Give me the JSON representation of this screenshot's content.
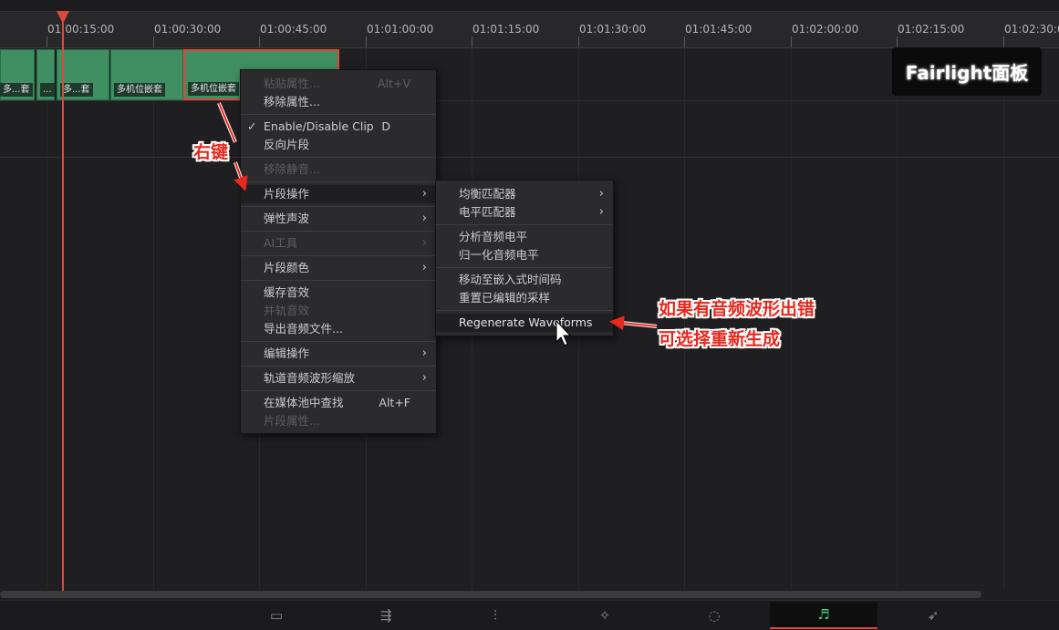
{
  "ruler": {
    "timecodes": [
      "01:00:15:00",
      "01:00:30:00",
      "01:00:45:00",
      "01:01:00:00",
      "01:01:15:00",
      "01:01:30:00",
      "01:01:45:00",
      "01:02:00:00",
      "01:02:15:00",
      "01:02:30:00"
    ]
  },
  "clips": [
    {
      "label": "多...套"
    },
    {
      "label": "..."
    },
    {
      "label": "多...套"
    },
    {
      "label": "多机位嵌套"
    },
    {
      "label": "多机位嵌套"
    }
  ],
  "badge": {
    "text": "Fairlight面板"
  },
  "context_menu": {
    "items": [
      {
        "label": "粘贴属性...",
        "shortcut": "Alt+V",
        "disabled": true
      },
      {
        "label": "移除属性...",
        "disabled": false
      },
      {
        "label": "Enable/Disable Clip",
        "shortcut": "D",
        "checked": true
      },
      {
        "label": "反向片段"
      },
      {
        "label": "移除静音...",
        "disabled": true
      },
      {
        "label": "片段操作",
        "submenu": true,
        "hover": true
      },
      {
        "label": "弹性声波",
        "submenu": true
      },
      {
        "label": "AI工具",
        "submenu": true,
        "disabled": true
      },
      {
        "label": "片段颜色",
        "submenu": true
      },
      {
        "label": "缓存音效"
      },
      {
        "label": "并轨音效",
        "disabled": true
      },
      {
        "label": "导出音频文件..."
      },
      {
        "label": "编辑操作",
        "submenu": true
      },
      {
        "label": "轨道音频波形缩放",
        "submenu": true
      },
      {
        "label": "在媒体池中查找",
        "shortcut": "Alt+F"
      },
      {
        "label": "片段属性...",
        "disabled": true
      }
    ]
  },
  "submenu": {
    "items": [
      {
        "label": "均衡匹配器",
        "submenu": true
      },
      {
        "label": "电平匹配器",
        "submenu": true
      },
      {
        "label": "分析音频电平"
      },
      {
        "label": "归一化音频电平"
      },
      {
        "label": "移动至嵌入式时间码"
      },
      {
        "label": "重置已编辑的采样"
      },
      {
        "label": "Regenerate Waveforms",
        "hover": true
      }
    ]
  },
  "annotations": {
    "right_click": "右键",
    "tip_line1": "如果有音频波形出错",
    "tip_line2": "可选择重新生成",
    "color": "#e8281e"
  },
  "page_nav": {
    "pages": [
      {
        "icon": "media-page-icon",
        "glyph": "▭"
      },
      {
        "icon": "cut-page-icon",
        "glyph": "⇶"
      },
      {
        "icon": "edit-page-icon",
        "glyph": "⫶"
      },
      {
        "icon": "fusion-page-icon",
        "glyph": "✧"
      },
      {
        "icon": "color-page-icon",
        "glyph": "◌"
      },
      {
        "icon": "fairlight-page-icon",
        "glyph": "♬",
        "active": true
      },
      {
        "icon": "deliver-page-icon",
        "glyph": "➶"
      }
    ]
  },
  "colors": {
    "accent": "#e0473b",
    "clip": "#3f8f62",
    "fairlight_active": "#3fcf7a"
  }
}
